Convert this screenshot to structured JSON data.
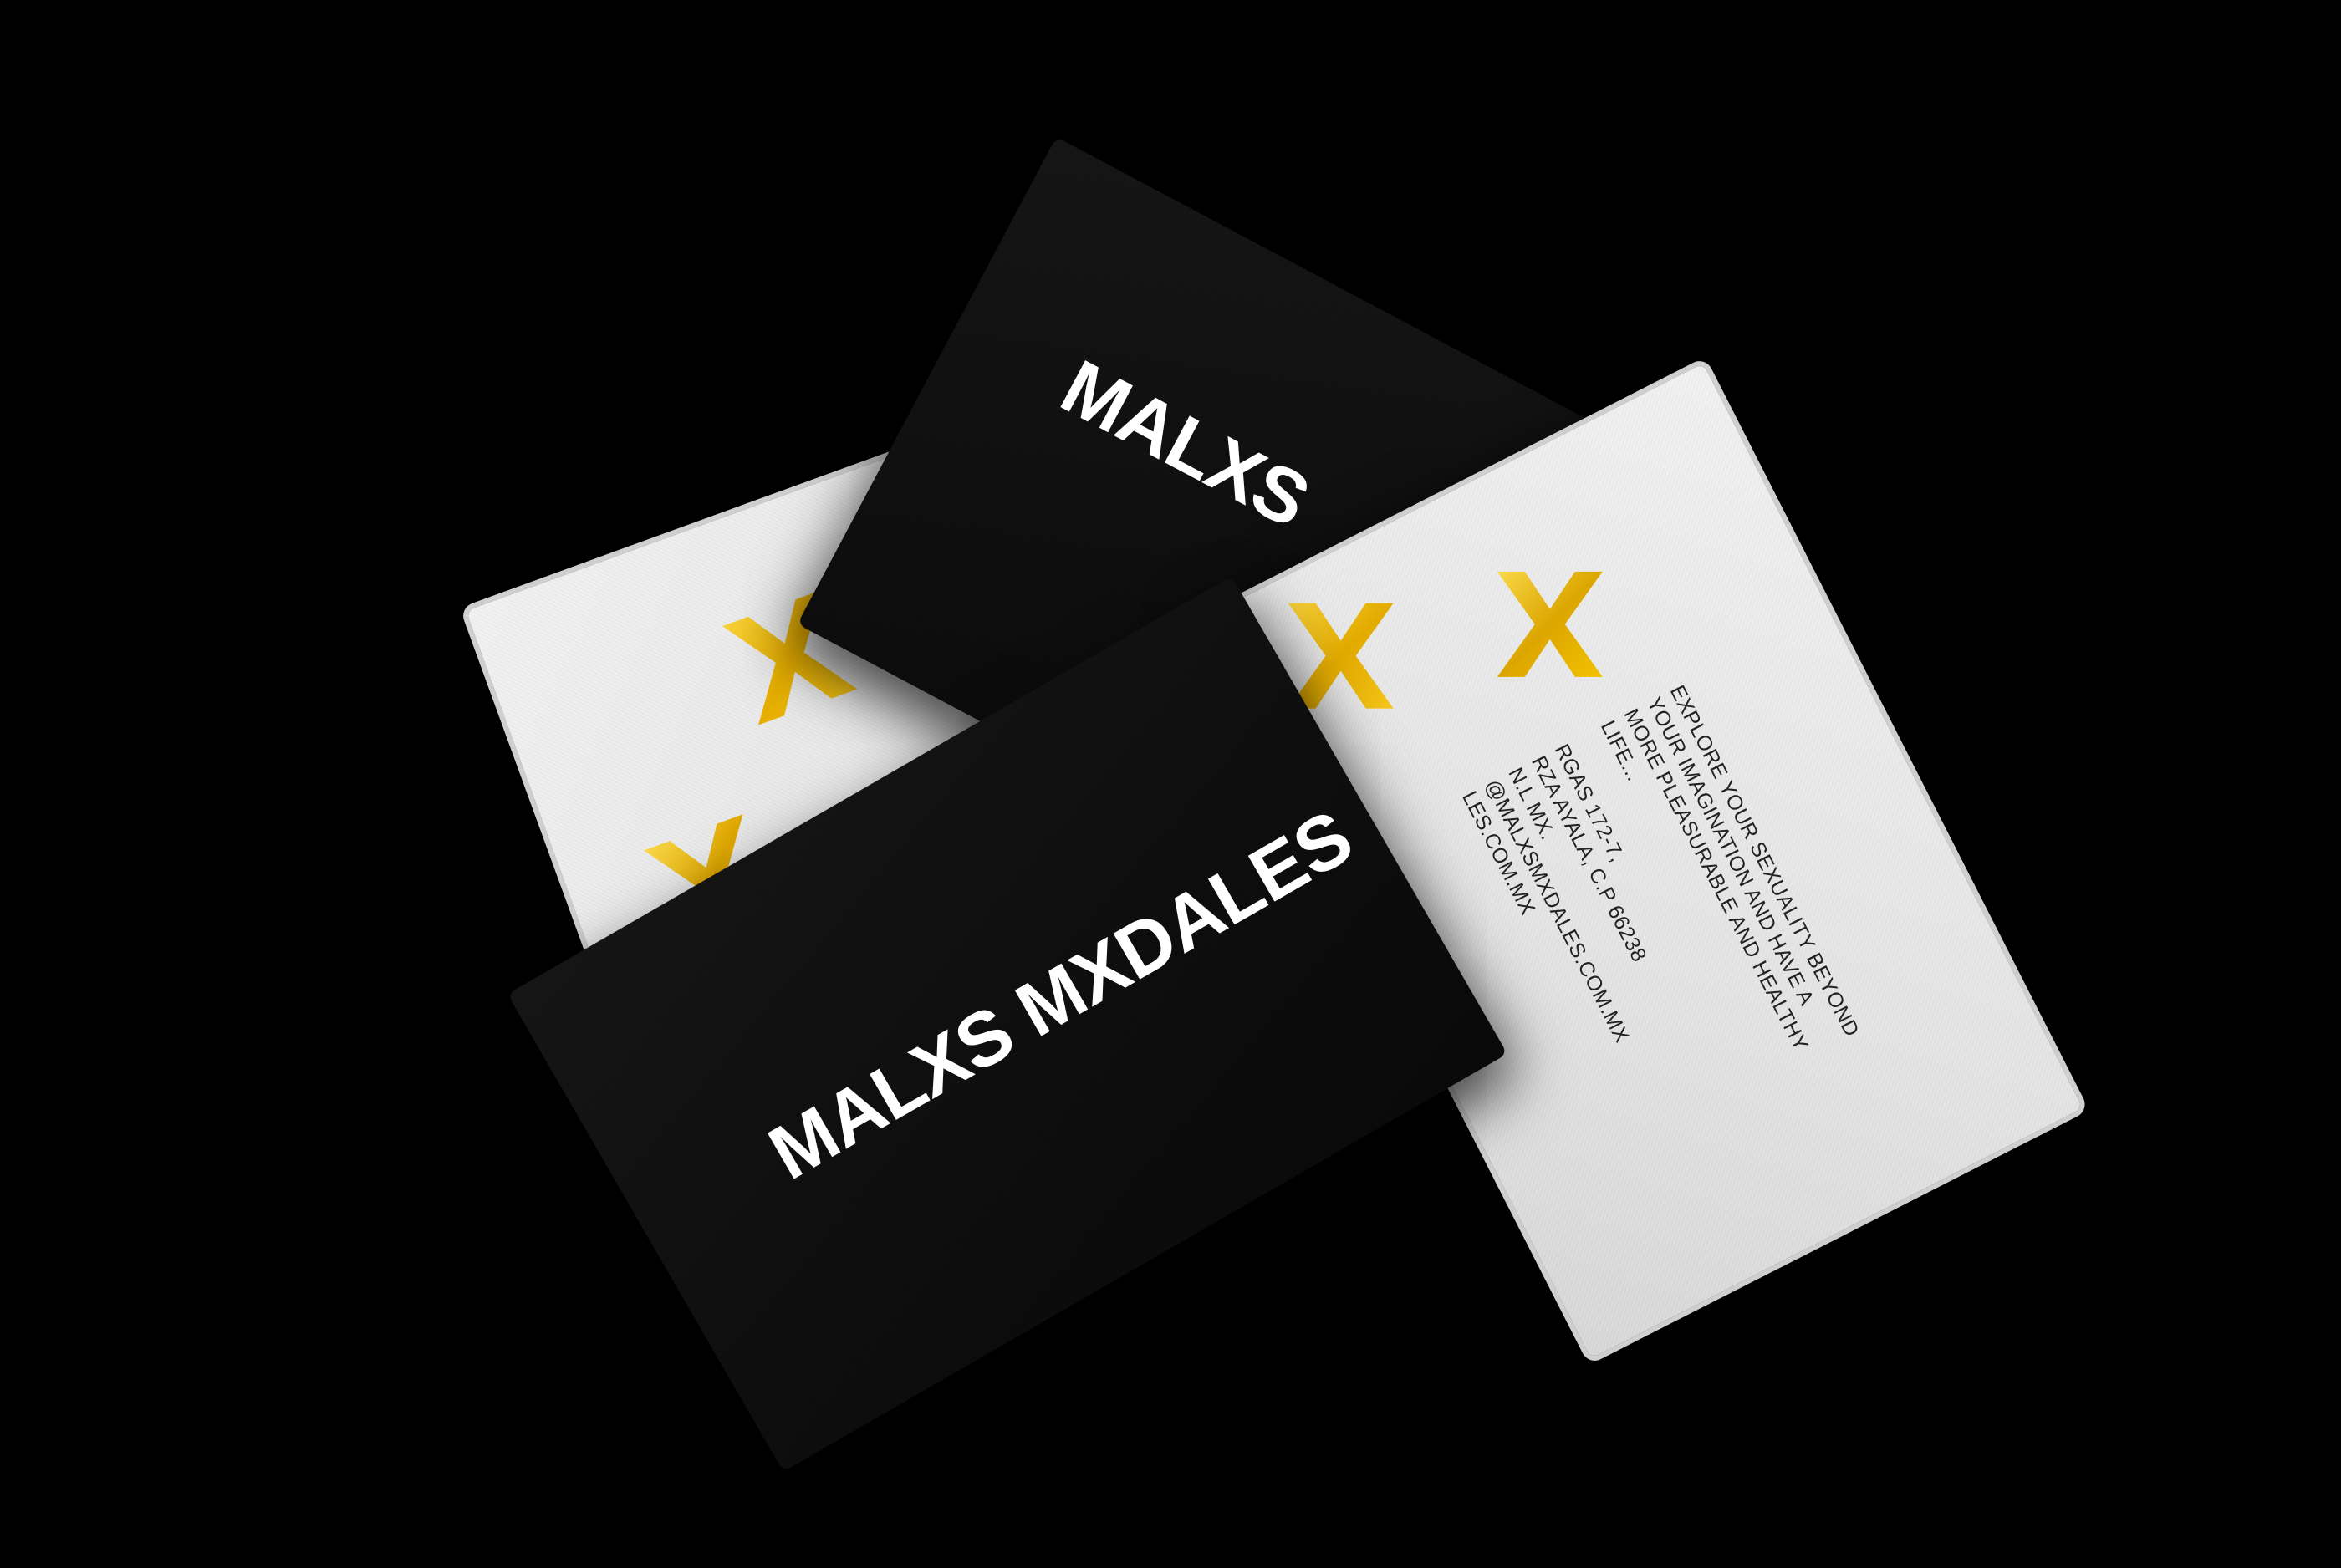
{
  "brand": {
    "name": "MALXS MXDALES",
    "name_partial": "MALXS"
  },
  "contact": {
    "tagline_1": "EXPLORE YOUR SEXUALITY BEYOND",
    "tagline_2": "YOUR IMAGINATION AND HAVE A",
    "tagline_3": "MORE PLEASURABLE AND HEALTHY",
    "tagline_4": "LIFE...",
    "address_1": "RGAS 172-7,",
    "address_2": "RZA AYALA, C.P 66238",
    "address_3": "N.L MX.",
    "email": "@MALXSMXDALES.COM.MX",
    "website": "LES.COM.MX"
  },
  "decor": {
    "small_x": "×"
  },
  "colors": {
    "background": "#000000",
    "gold": "#f2c200",
    "gold_dark": "#c99500",
    "card_white": "#eaeaea",
    "card_black": "#0d0d0d"
  },
  "icons": [
    "gold-x-icon"
  ]
}
